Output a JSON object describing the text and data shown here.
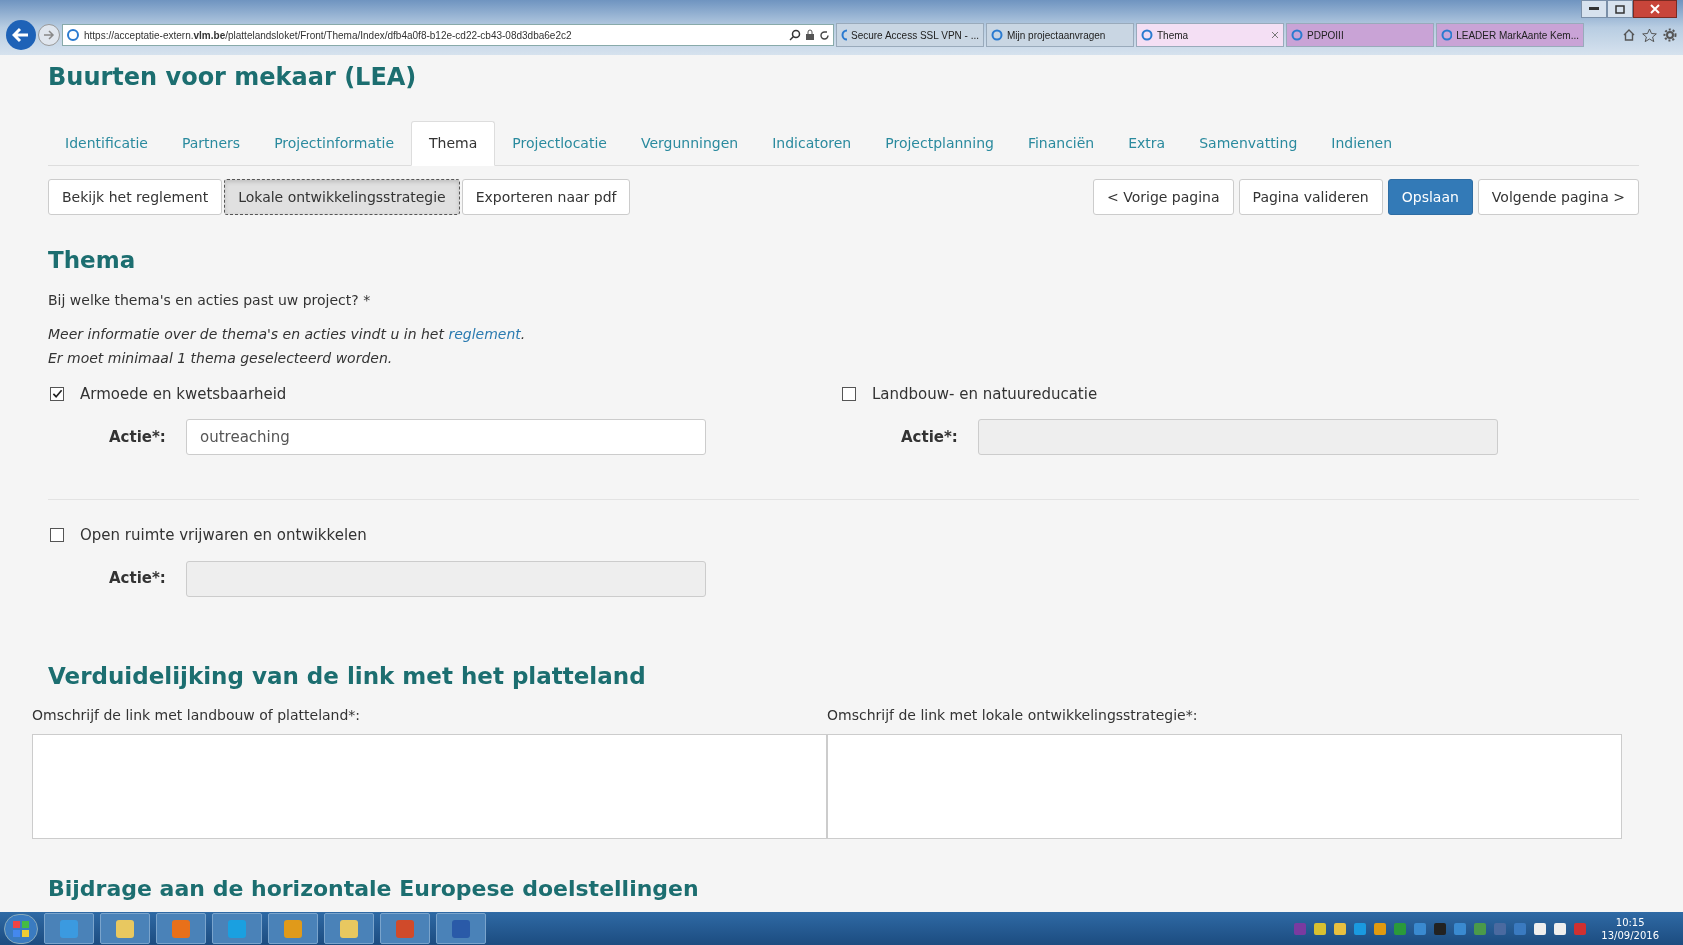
{
  "browser": {
    "address": {
      "prefix": "https://acceptatie-extern.",
      "host": "vlm.be",
      "path": "/plattelandsloket/Front/Thema/Index/dfb4a0f8-b12e-cd22-cb43-08d3dba6e2c2"
    },
    "tabs": [
      {
        "label": "Secure Access SSL VPN - ...",
        "selected": false,
        "color": "#c9d6e3"
      },
      {
        "label": "Mijn projectaanvragen",
        "selected": false,
        "color": "#c9d6e3"
      },
      {
        "label": "Thema",
        "selected": true,
        "color": "#f4dff4"
      },
      {
        "label": "PDPOIII",
        "selected": false,
        "color": "#c9a3d6"
      },
      {
        "label": "LEADER MarkAante Kem...",
        "selected": false,
        "color": "#c9a3d6"
      }
    ]
  },
  "page": {
    "title": "Buurten voor mekaar (LEA)",
    "tabs": [
      {
        "label": "Identificatie",
        "selected": false
      },
      {
        "label": "Partners",
        "selected": false
      },
      {
        "label": "Projectinformatie",
        "selected": false
      },
      {
        "label": "Thema",
        "selected": true
      },
      {
        "label": "Projectlocatie",
        "selected": false
      },
      {
        "label": "Vergunningen",
        "selected": false
      },
      {
        "label": "Indicatoren",
        "selected": false
      },
      {
        "label": "Projectplanning",
        "selected": false
      },
      {
        "label": "Financiën",
        "selected": false
      },
      {
        "label": "Extra",
        "selected": false
      },
      {
        "label": "Samenvatting",
        "selected": false
      },
      {
        "label": "Indienen",
        "selected": false
      }
    ],
    "left_buttons": [
      {
        "label": "Bekijk het reglement",
        "selected": false
      },
      {
        "label": "Lokale ontwikkelingsstrategie",
        "selected": true
      },
      {
        "label": "Exporteren naar pdf",
        "selected": false
      }
    ],
    "right_buttons": [
      {
        "label": "< Vorige pagina",
        "kind": "default"
      },
      {
        "label": "Pagina valideren",
        "kind": "default"
      },
      {
        "label": "Opslaan",
        "kind": "primary"
      },
      {
        "label": "Volgende pagina >",
        "kind": "default"
      }
    ],
    "thema": {
      "heading": "Thema",
      "question": "Bij welke thema's en acties past uw project? *",
      "info": {
        "before": "Meer informatie over de thema's en acties vindt u in het ",
        "link": "reglement",
        "after": "."
      },
      "rule": "Er moet minimaal 1 thema geselecteerd worden.",
      "themes": [
        {
          "label": "Armoede en kwetsbaarheid",
          "checked": true,
          "action_label": "Actie*:",
          "value": "outreaching"
        },
        {
          "label": "Landbouw- en natuureducatie",
          "checked": false,
          "action_label": "Actie*:"
        },
        {
          "label": "Open ruimte vrijwaren en ontwikkelen",
          "checked": false,
          "action_label": "Actie*:"
        }
      ]
    },
    "link_section": {
      "heading": "Verduidelijking van de link met het platteland",
      "fields": [
        {
          "label": "Omschrijf de link met landbouw of platteland*:"
        },
        {
          "label": "Omschrijf de link met lokale ontwikkelingsstrategie*:"
        }
      ]
    },
    "next_heading": "Bijdrage aan de horizontale Europese doelstellingen"
  },
  "taskbar": {
    "time": "10:15",
    "date": "13/09/2016"
  }
}
